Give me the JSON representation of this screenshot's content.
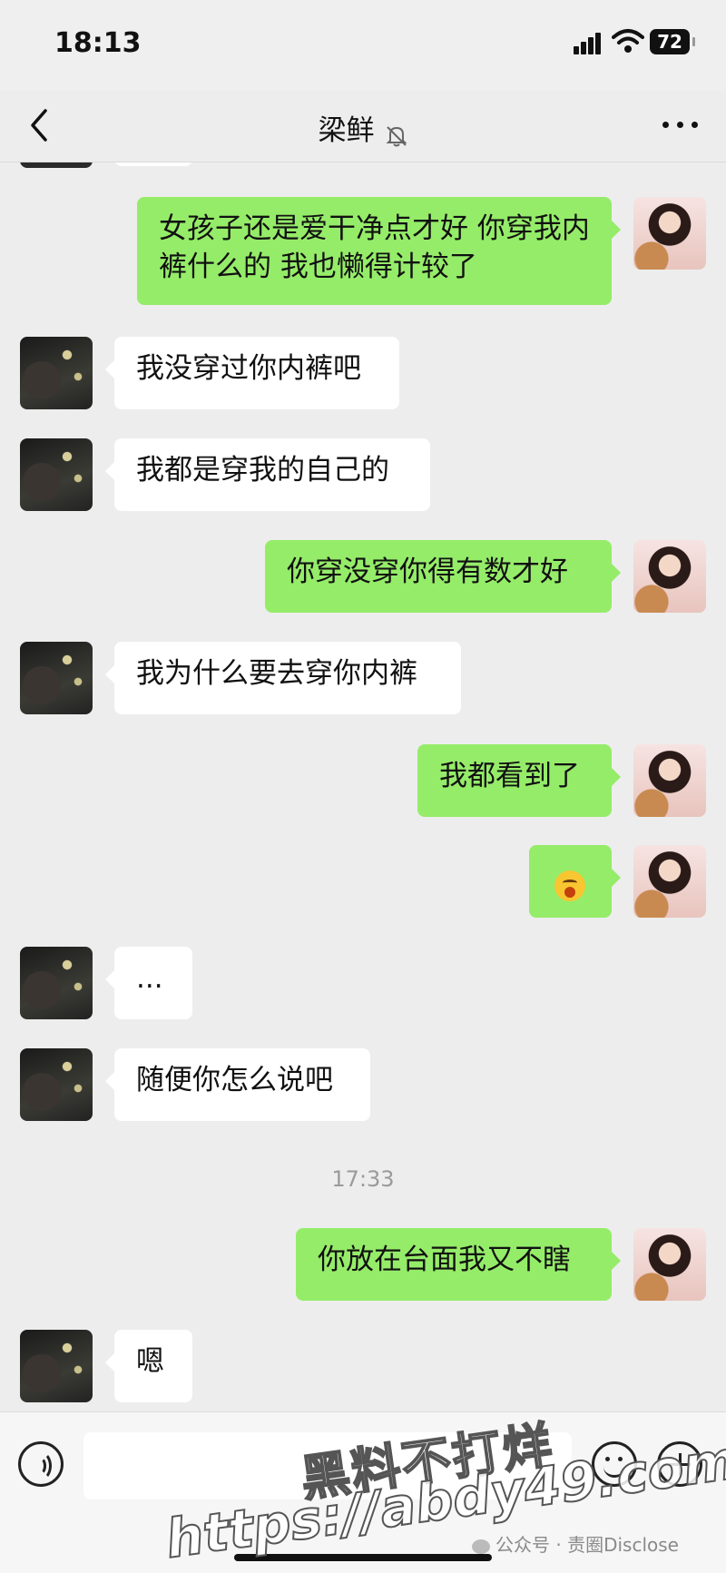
{
  "status_bar": {
    "time": "18:13",
    "battery": "72"
  },
  "header": {
    "contact_name": "梁鲜"
  },
  "messages": [
    {
      "from": "me",
      "text": "女孩子还是爱干净点才好 你穿我内裤什么的 我也懒得计较了"
    },
    {
      "from": "other",
      "text": "我没穿过你内裤吧"
    },
    {
      "from": "other",
      "text": "我都是穿我的自己的"
    },
    {
      "from": "me",
      "text": "你穿没穿你得有数才好"
    },
    {
      "from": "other",
      "text": "我为什么要去穿你内裤"
    },
    {
      "from": "me",
      "text": "我都看到了"
    },
    {
      "from": "me",
      "emoji": "yawning-face-emoji"
    },
    {
      "from": "other",
      "text": "..."
    },
    {
      "from": "other",
      "text": "随便你怎么说吧"
    },
    {
      "from": "me",
      "text": "你放在台面我又不瞎"
    },
    {
      "from": "other",
      "text": "嗯"
    }
  ],
  "timestamp": "17:33",
  "watermark": {
    "line1": "黑料不打烊",
    "line2": "https://abdy49.com",
    "source": "公众号 · 责圈Disclose"
  },
  "colors": {
    "my_bubble": "#95ec69",
    "other_bubble": "#ffffff",
    "background": "#ededed"
  }
}
